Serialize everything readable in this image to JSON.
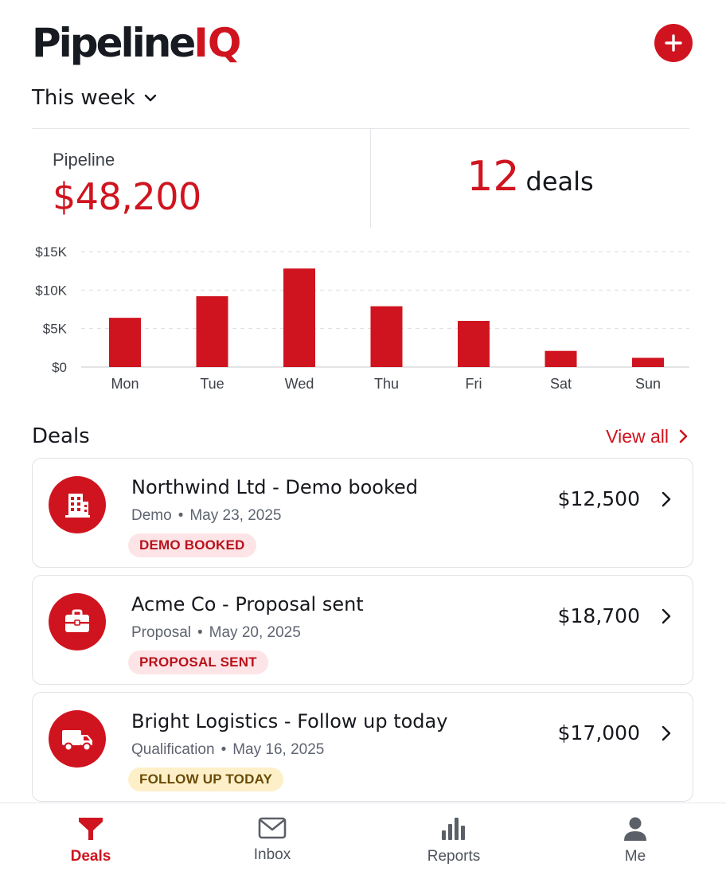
{
  "app": {
    "logo_main": "Pipeline",
    "logo_accent": "IQ",
    "brand_color": "#d0141f"
  },
  "header": {
    "add_icon": "plus-icon"
  },
  "period": {
    "label": "This week",
    "icon": "chevron-down-icon"
  },
  "summary": {
    "pipeline_label": "Pipeline",
    "pipeline_value": "$48,200",
    "deals_count": "12",
    "deals_unit": "deals"
  },
  "chart_data": {
    "type": "bar",
    "categories": [
      "Mon",
      "Tue",
      "Wed",
      "Thu",
      "Fri",
      "Sat",
      "Sun"
    ],
    "values": [
      6400,
      9200,
      12800,
      7900,
      6000,
      2100,
      1200
    ],
    "ylim": [
      0,
      15000
    ],
    "yticks": [
      0,
      5000,
      10000,
      15000
    ],
    "ytick_labels": [
      "$0",
      "$5K",
      "$10K",
      "$15K"
    ],
    "grid": true,
    "color": "#d0141f"
  },
  "deals_section": {
    "title": "Deals",
    "view_all": "View all"
  },
  "deals": [
    {
      "title": "Northwind Ltd - Demo booked",
      "stage": "Demo",
      "date": "May 23, 2025",
      "amount": "$12,500",
      "badge": "DEMO BOOKED",
      "badge_tone": "red",
      "icon": "building-icon"
    },
    {
      "title": "Acme Co - Proposal sent",
      "stage": "Proposal",
      "date": "May 20, 2025",
      "amount": "$18,700",
      "badge": "PROPOSAL SENT",
      "badge_tone": "red",
      "icon": "briefcase-icon"
    },
    {
      "title": "Bright Logistics -  Follow up today",
      "stage": "Qualification",
      "date": "May 16, 2025",
      "amount": "$17,000",
      "badge": "FOLLOW UP TODAY",
      "badge_tone": "yellow",
      "icon": "truck-icon"
    }
  ],
  "tabs": [
    {
      "label": "Deals",
      "icon": "funnel-icon",
      "active": true
    },
    {
      "label": "Inbox",
      "icon": "mail-icon",
      "active": false
    },
    {
      "label": "Reports",
      "icon": "bar-chart-icon",
      "active": false
    },
    {
      "label": "Me",
      "icon": "person-icon",
      "active": false
    }
  ]
}
